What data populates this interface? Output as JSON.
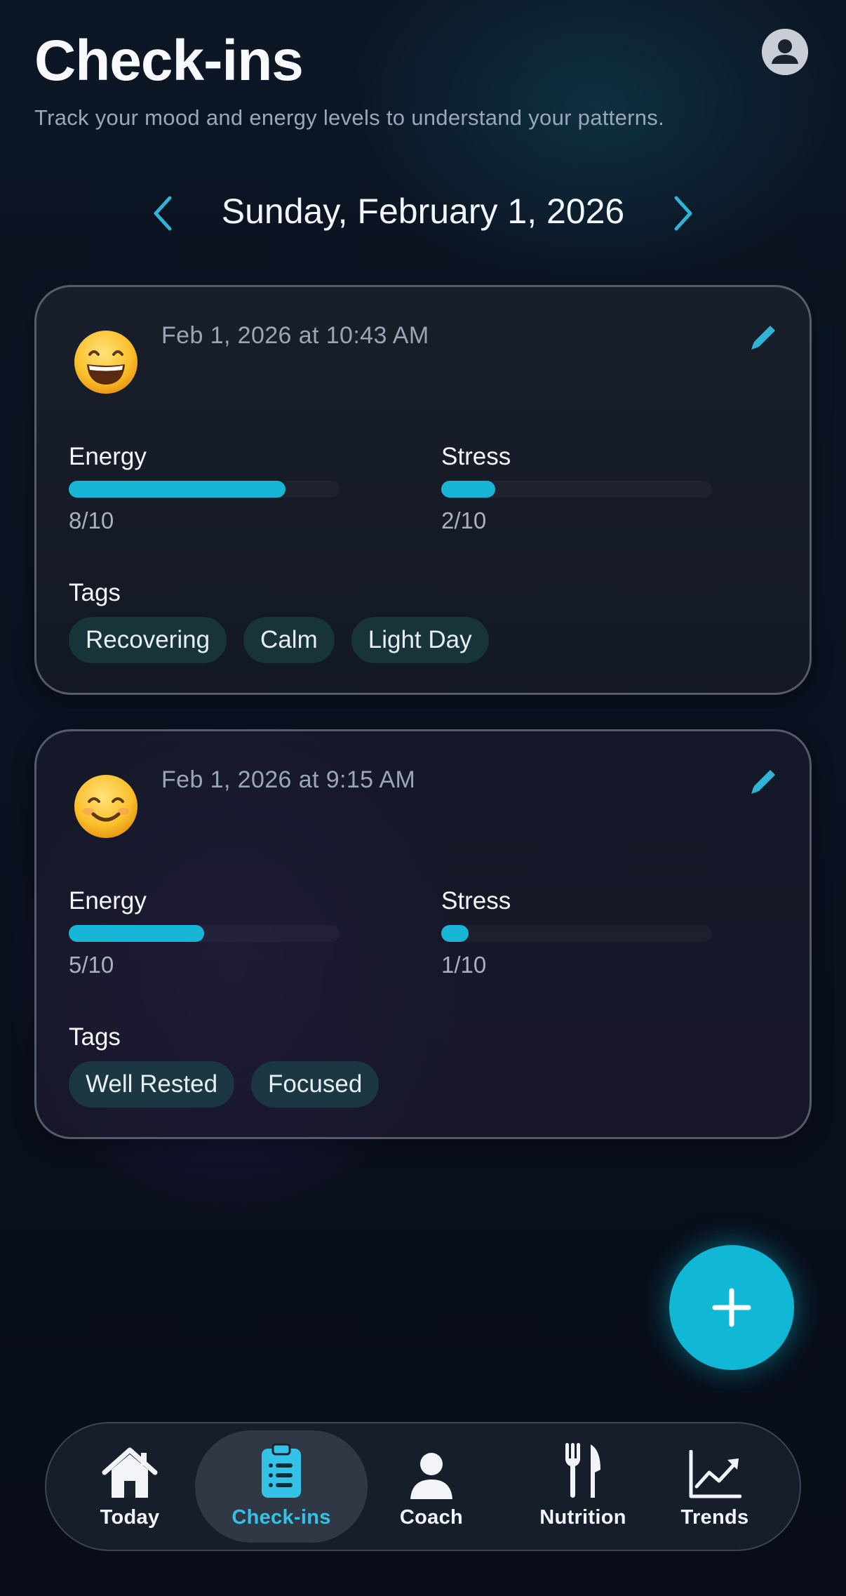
{
  "header": {
    "title": "Check-ins",
    "subtitle": "Track your mood and energy levels to understand your patterns."
  },
  "date_nav": {
    "date": "Sunday, February 1, 2026"
  },
  "checkins": [
    {
      "emoji": "grinning-face",
      "timestamp": "Feb 1, 2026 at 10:43 AM",
      "energy_label": "Energy",
      "energy_value": "8/10",
      "energy_level": 0.8,
      "stress_label": "Stress",
      "stress_value": "2/10",
      "stress_level": 0.2,
      "tags_label": "Tags",
      "tags": [
        "Recovering",
        "Calm",
        "Light Day"
      ]
    },
    {
      "emoji": "smiling-face",
      "timestamp": "Feb 1, 2026 at 9:15 AM",
      "energy_label": "Energy",
      "energy_value": "5/10",
      "energy_level": 0.5,
      "stress_label": "Stress",
      "stress_value": "1/10",
      "stress_level": 0.1,
      "tags_label": "Tags",
      "tags": [
        "Well Rested",
        "Focused"
      ]
    }
  ],
  "tabbar": {
    "items": [
      {
        "label": "Today",
        "icon": "home-icon"
      },
      {
        "label": "Check-ins",
        "icon": "clipboard-icon",
        "active": true
      },
      {
        "label": "Coach",
        "icon": "person-icon"
      },
      {
        "label": "Nutrition",
        "icon": "fork-knife-icon"
      },
      {
        "label": "Trends",
        "icon": "chart-icon"
      }
    ]
  },
  "colors": {
    "accent": "#17b6d6",
    "active_tab": "#34c2e6",
    "tag_bg": "#16343a"
  }
}
